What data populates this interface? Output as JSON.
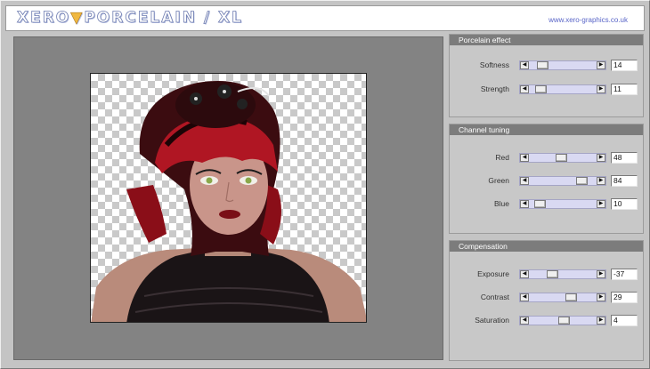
{
  "header": {
    "logo_text": "XERO PORCELAIN / XL",
    "logo_part1": "XERO",
    "logo_part2": "PORCELAIN / XL",
    "site_link": "www.xero-graphics.co.uk"
  },
  "preview": {
    "background": "transparent checkerboard",
    "image": "portrait-render"
  },
  "groups": [
    {
      "title": "Porcelain effect",
      "rows": [
        {
          "label": "Softness",
          "value": "14",
          "fraction": 0.14
        },
        {
          "label": "Strength",
          "value": "11",
          "fraction": 0.11
        }
      ]
    },
    {
      "title": "Channel tuning",
      "rows": [
        {
          "label": "Red",
          "value": "48",
          "fraction": 0.48
        },
        {
          "label": "Green",
          "value": "84",
          "fraction": 0.84
        },
        {
          "label": "Blue",
          "value": "10",
          "fraction": 0.1
        }
      ]
    },
    {
      "title": "Compensation",
      "rows": [
        {
          "label": "Exposure",
          "value": "-37",
          "fraction": 0.315
        },
        {
          "label": "Contrast",
          "value": "29",
          "fraction": 0.645
        },
        {
          "label": "Saturation",
          "value": "4",
          "fraction": 0.52
        }
      ]
    }
  ],
  "colors": {
    "slider_track": "#d9d9f2",
    "group_header": "#7c7c7c",
    "canvas": "#838383",
    "link": "#5a66c8"
  }
}
